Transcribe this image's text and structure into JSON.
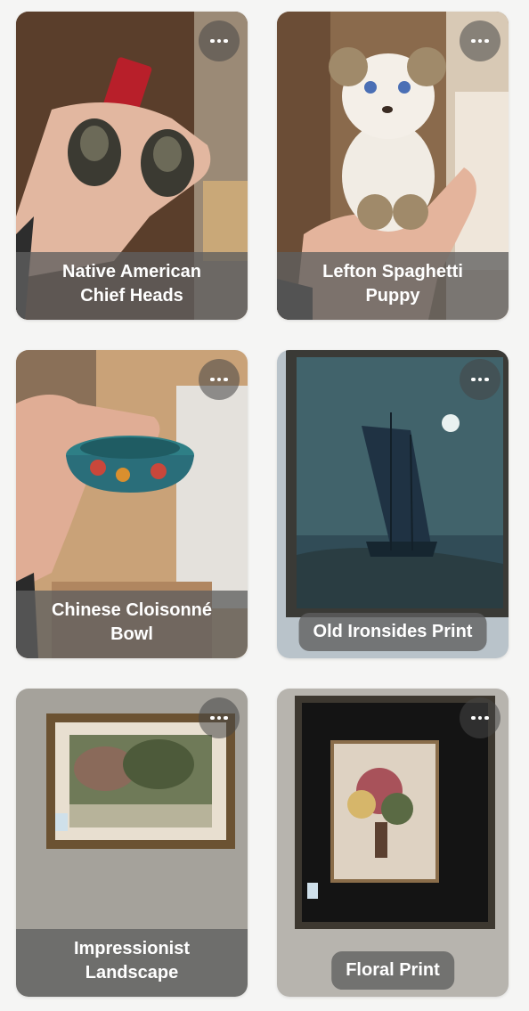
{
  "items": [
    {
      "title_line1": "Native American",
      "title_line2": "Chief Heads",
      "menu_icon": "more-horizontal-icon"
    },
    {
      "title_line1": "Lefton Spaghetti",
      "title_line2": "Puppy",
      "menu_icon": "more-horizontal-icon"
    },
    {
      "title_line1": "Chinese Cloisonné",
      "title_line2": "Bowl",
      "menu_icon": "more-horizontal-icon"
    },
    {
      "title_line1": "Old Ironsides Print",
      "title_line2": "",
      "menu_icon": "more-horizontal-icon"
    },
    {
      "title_line1": "Impressionist",
      "title_line2": "Landscape",
      "menu_icon": "more-horizontal-icon"
    },
    {
      "title_line1": "Floral Print",
      "title_line2": "",
      "menu_icon": "more-horizontal-icon"
    }
  ]
}
